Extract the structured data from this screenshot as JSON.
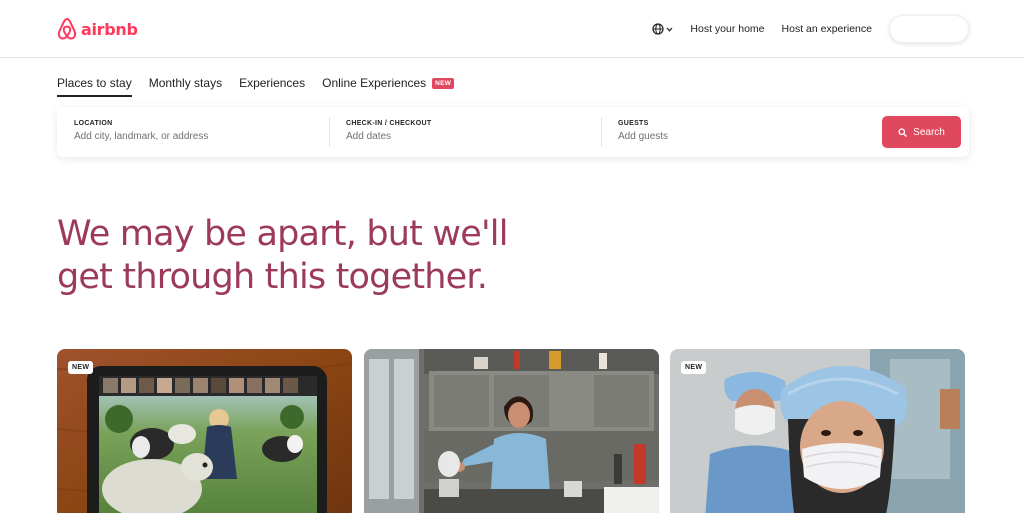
{
  "header": {
    "logo_text": "airbnb",
    "host_home": "Host your home",
    "host_experience": "Host an experience"
  },
  "tabs": [
    {
      "label": "Places to stay",
      "active": true
    },
    {
      "label": "Monthly stays",
      "active": false
    },
    {
      "label": "Experiences",
      "active": false
    },
    {
      "label": "Online Experiences",
      "active": false,
      "badge": "NEW"
    }
  ],
  "search": {
    "location": {
      "label": "LOCATION",
      "placeholder": "Add city, landmark, or address"
    },
    "dates": {
      "label": "CHECK-IN / CHECKOUT",
      "placeholder": "Add dates"
    },
    "guests": {
      "label": "GUESTS",
      "placeholder": "Add guests"
    },
    "button_label": "Search"
  },
  "hero": {
    "line1": "We may be apart, but we'll",
    "line2": "get through this together."
  },
  "cards": [
    {
      "badge": "NEW",
      "image": "online-experience-with-sheep"
    },
    {
      "badge": "",
      "image": "man-cooking-in-kitchen"
    },
    {
      "badge": "NEW",
      "image": "healthcare-workers-with-masks"
    }
  ],
  "colors": {
    "brand": "#ff385c",
    "button": "#e0485e",
    "hero_text": "#9c3a5d"
  }
}
